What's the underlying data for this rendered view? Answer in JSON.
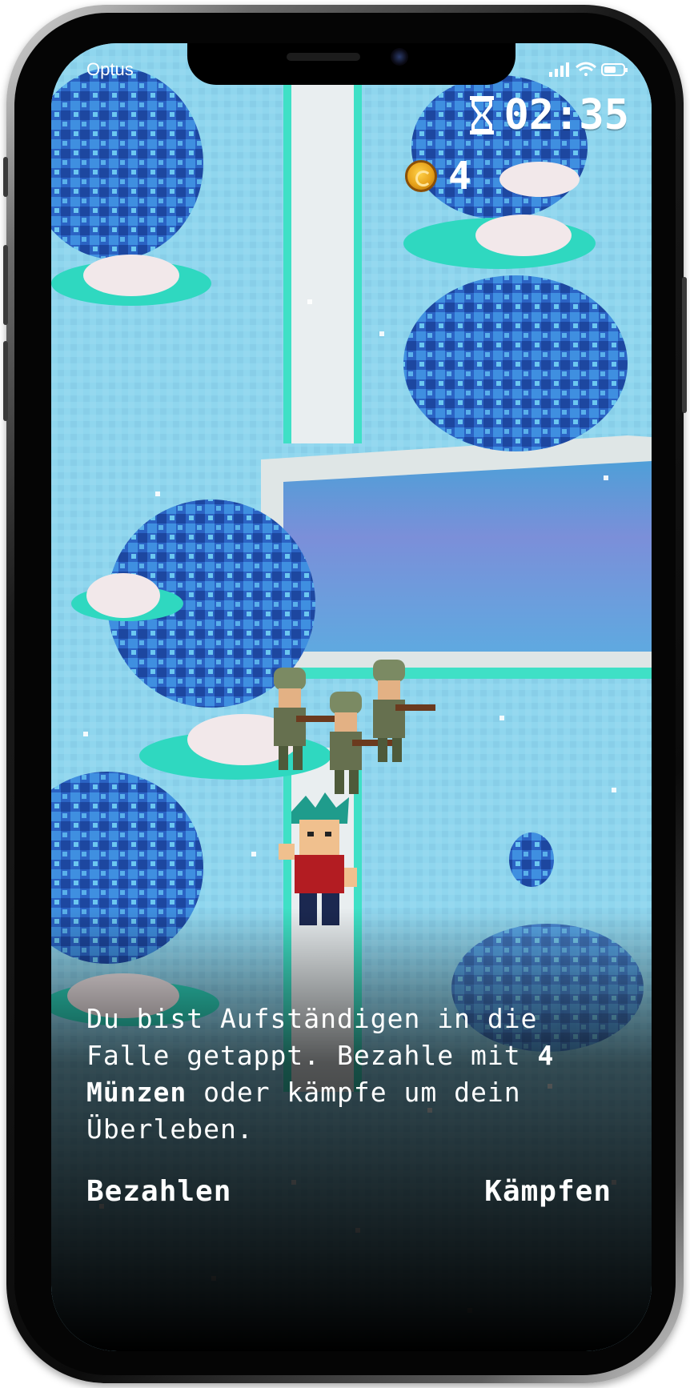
{
  "status_bar": {
    "carrier": "Optus",
    "icons": [
      "signal-icon",
      "wifi-icon",
      "battery-icon"
    ]
  },
  "hud": {
    "timer_icon": "hourglass-icon",
    "timer": "02:35",
    "coin_icon": "coin-icon",
    "coins": "4"
  },
  "dialog": {
    "text_before": "Du bist Aufständigen in die Falle getappt. Bezahle mit ",
    "text_bold": "4 Münzen",
    "text_after": " oder kämpfe um dein Überleben.",
    "pay_label": "Bezahlen",
    "fight_label": "Kämpfen"
  },
  "colors": {
    "water": "#7fd4ee",
    "tree": "#2d6fd1",
    "path": "#e7eef0",
    "background_bottom": "#000000"
  }
}
